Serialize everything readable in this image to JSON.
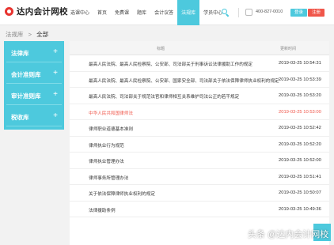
{
  "brand": {
    "name": "达内会计网校"
  },
  "nav": {
    "items": [
      "选课中心",
      "首页",
      "免费课",
      "题库",
      "会计议答",
      "法规库",
      "学员中心"
    ],
    "active_index": 5
  },
  "header": {
    "phone": "400-827-0010",
    "login_label": "登录",
    "register_label": "注册"
  },
  "breadcrumb": {
    "root": "法规库",
    "separator": ">",
    "current": "全部"
  },
  "sidebar": {
    "items": [
      {
        "label": "法律库",
        "expand": "+"
      },
      {
        "label": "会计准则库",
        "expand": "+"
      },
      {
        "label": "审计准则库",
        "expand": "+"
      },
      {
        "label": "税收库",
        "expand": "+"
      }
    ]
  },
  "table": {
    "columns": [
      "标题",
      "更新时间"
    ],
    "rows": [
      {
        "title": "最高人民法院、最高人民检察院、公安部、司法部关于刑事诉讼法律援助工作的规定",
        "time": "2019-03-25 10:54:31"
      },
      {
        "title": "最高人民法院、最高人民检察院、公安部、国家安全部、司法部关于依法保障律师执业权利的规定",
        "time": "2019-03-25 10:53:39"
      },
      {
        "title": "最高人民法院、司法部关于规范法官和律师相互关系维护司法公正的若干规定",
        "time": "2019-03-25 10:53:20"
      },
      {
        "title": "中华人民共和国律师法",
        "time": "2019-03-25 10:53:00",
        "highlight": true
      },
      {
        "title": "律师职业道德基本准则",
        "time": "2019-03-25 10:52:42"
      },
      {
        "title": "律师执业行为规范",
        "time": "2019-03-25 10:52:20"
      },
      {
        "title": "律师执业管理办法",
        "time": "2019-03-25 10:52:00"
      },
      {
        "title": "律师事务所管理办法",
        "time": "2019-03-25 10:51:41"
      },
      {
        "title": "关于依法保障律师执业权利的规定",
        "time": "2019-03-25 10:50:07"
      },
      {
        "title": "法律援助条例",
        "time": "2019-03-25 10:49:36"
      }
    ]
  },
  "watermark": {
    "text": "头条 @达内会计网校"
  },
  "colors": {
    "accent": "#4dc9dd",
    "highlight": "#f0564a",
    "brand_red": "#e8342f"
  },
  "icons": {
    "logo": "logo-icon",
    "search": "search-icon",
    "phone": "phone-icon",
    "expand": "plus-icon"
  }
}
